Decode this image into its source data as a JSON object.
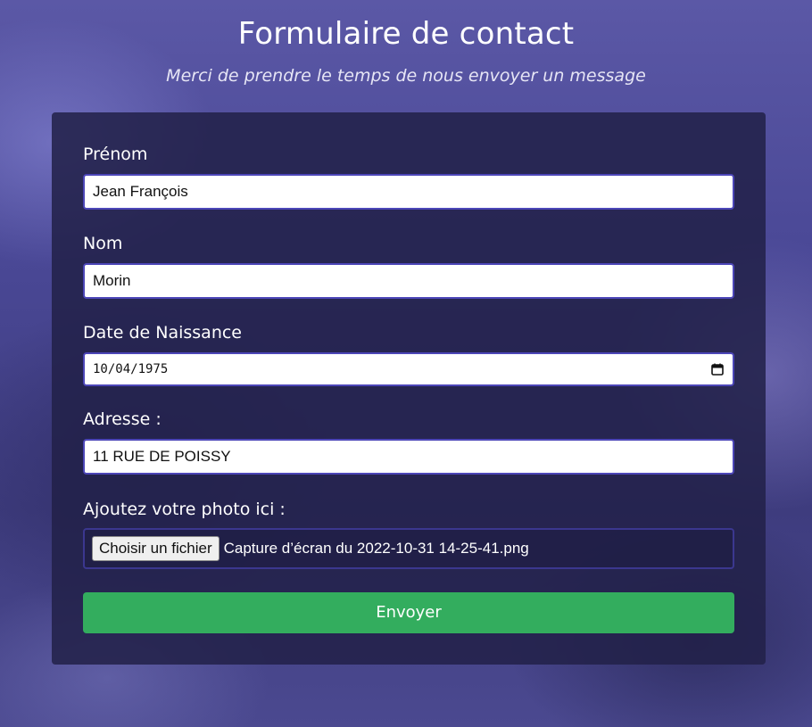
{
  "header": {
    "title": "Formulaire de contact",
    "subtitle": "Merci de prendre le temps de nous envoyer un message"
  },
  "form": {
    "first_name": {
      "label": "Prénom",
      "value": "Jean François"
    },
    "last_name": {
      "label": "Nom",
      "value": "Morin"
    },
    "birth_date": {
      "label": "Date de Naissance",
      "value": "10/04/1975",
      "icon": "calendar-icon"
    },
    "address": {
      "label": "Adresse :",
      "value": "11 RUE DE POISSY"
    },
    "photo": {
      "label": "Ajoutez votre photo ici :",
      "button": "Choisir un fichier",
      "file_name": "Capture d’écran du 2022-10-31 14-25-41.png"
    },
    "submit": "Envoyer"
  },
  "colors": {
    "accent": "#33ad5e",
    "input_border": "#4c46b8",
    "card_bg": "#222148"
  }
}
